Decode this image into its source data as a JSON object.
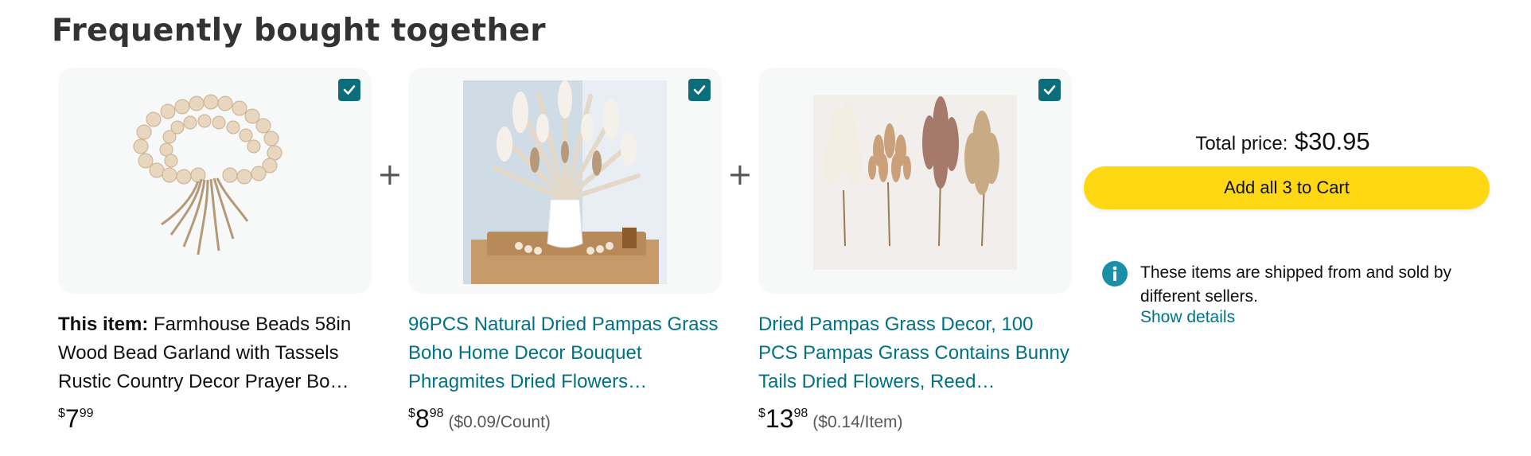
{
  "section": {
    "title": "Frequently bought together"
  },
  "items": [
    {
      "prefix": "This item:",
      "title": "Farmhouse Beads 58in Wood Bead Garland with Tassels Rustic Country Decor Prayer Bo…",
      "price_symbol": "$",
      "price_whole": "7",
      "price_fraction": "99",
      "unit_price": "",
      "checked": true
    },
    {
      "prefix": "",
      "title": "96PCS Natural Dried Pampas Grass Boho Home Decor Bouquet Phragmites Dried Flowers…",
      "price_symbol": "$",
      "price_whole": "8",
      "price_fraction": "98",
      "unit_price": "($0.09/Count)",
      "checked": true
    },
    {
      "prefix": "",
      "title": "Dried Pampas Grass Decor, 100 PCS Pampas Grass Contains Bunny Tails Dried Flowers, Reed…",
      "price_symbol": "$",
      "price_whole": "13",
      "price_fraction": "98",
      "unit_price": "($0.14/Item)",
      "checked": true
    }
  ],
  "plus_sign": "+",
  "summary": {
    "total_label": "Total price:",
    "total_amount": "$30.95",
    "add_button_label": "Add all 3 to Cart",
    "info_text": "These items are shipped from and sold by different sellers.",
    "show_details_label": "Show details"
  },
  "colors": {
    "accent_button": "#ffd814",
    "checkbox": "#0b6e7a",
    "link": "#007185",
    "info_icon": "#1a8fa8"
  },
  "icons": {
    "checkbox": "checkmark-icon",
    "info": "info-icon"
  }
}
